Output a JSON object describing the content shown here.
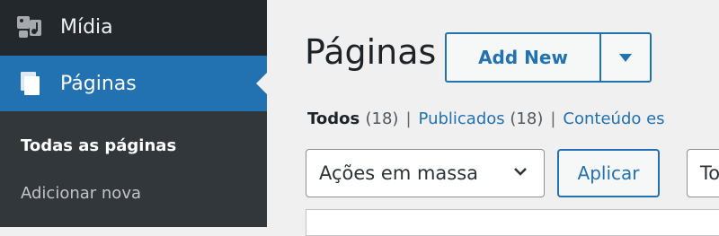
{
  "sidebar": {
    "items": [
      {
        "label": "Mídia",
        "icon": "media-icon"
      },
      {
        "label": "Páginas",
        "icon": "pages-icon"
      }
    ],
    "submenu": {
      "current": "Todas as páginas",
      "add": "Adicionar nova"
    },
    "colors": {
      "background": "#23282d",
      "active": "#2271b1",
      "submenu": "#32373c"
    }
  },
  "main": {
    "title": "Páginas",
    "add_new": "Add New",
    "views": {
      "all_label": "Todos",
      "all_count": "(18)",
      "published_label": "Publicados",
      "published_count": "(18)",
      "third_label": "Conteúdo es"
    },
    "bulk_actions": "Ações em massa",
    "apply": "Aplicar",
    "filter_partial": "To"
  }
}
